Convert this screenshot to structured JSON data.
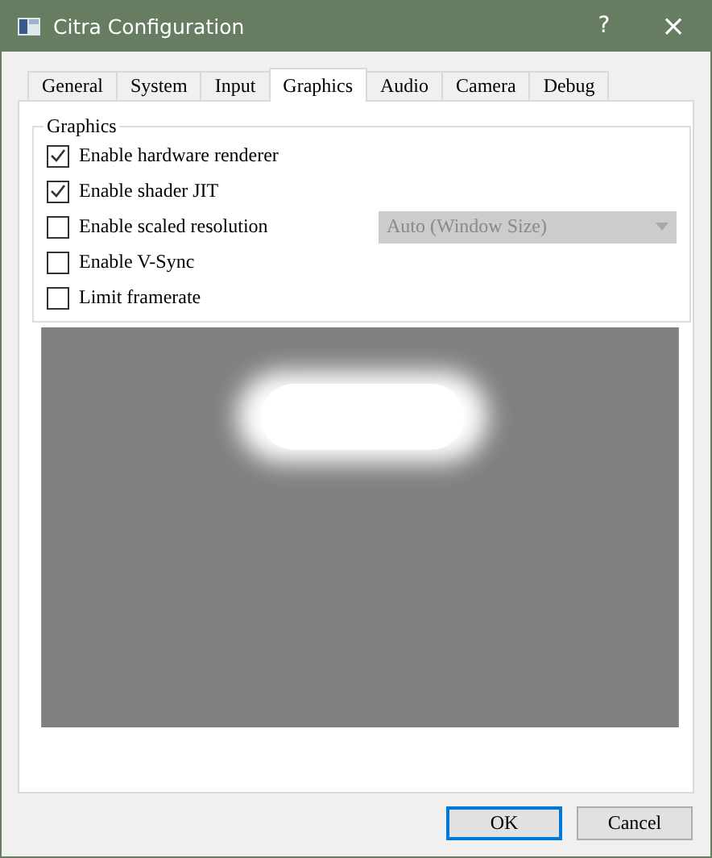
{
  "window": {
    "title": "Citra Configuration",
    "help": "?",
    "close": "×"
  },
  "tabs": [
    {
      "label": "General",
      "selected": false
    },
    {
      "label": "System",
      "selected": false
    },
    {
      "label": "Input",
      "selected": false
    },
    {
      "label": "Graphics",
      "selected": true
    },
    {
      "label": "Audio",
      "selected": false
    },
    {
      "label": "Camera",
      "selected": false
    },
    {
      "label": "Debug",
      "selected": false
    }
  ],
  "group": {
    "title": "Graphics",
    "options": [
      {
        "label": "Enable hardware renderer",
        "checked": true
      },
      {
        "label": "Enable shader JIT",
        "checked": true
      },
      {
        "label": "Enable scaled resolution",
        "checked": false,
        "dropdown": {
          "value": "Auto (Window Size)",
          "disabled": true
        }
      },
      {
        "label": "Enable V-Sync",
        "checked": false
      },
      {
        "label": "Limit framerate",
        "checked": false
      }
    ]
  },
  "buttons": [
    {
      "label": "OK",
      "selected": true
    },
    {
      "label": "Cancel",
      "selected": false
    }
  ]
}
